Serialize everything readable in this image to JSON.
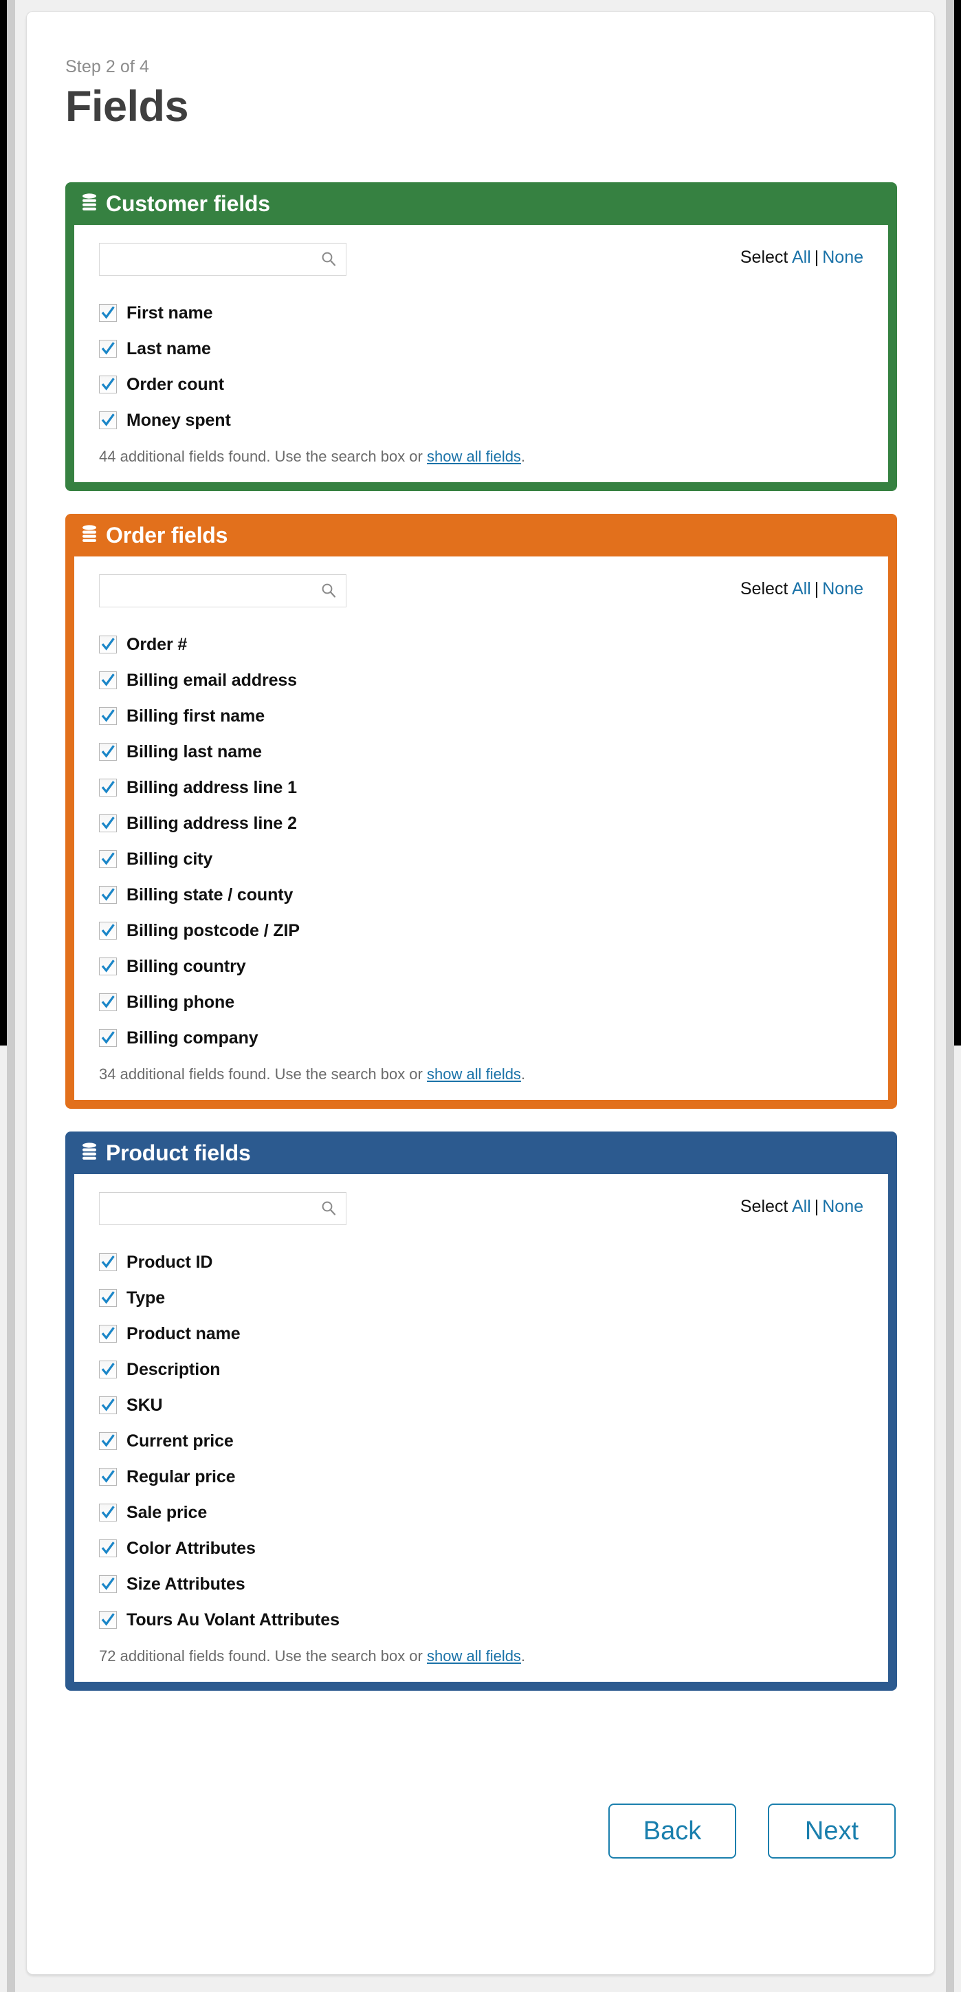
{
  "header": {
    "step_label": "Step 2 of 4",
    "title": "Fields"
  },
  "colors": {
    "customer_panel": "#368141",
    "order_panel": "#e2701c",
    "product_panel": "#2c5a8f",
    "link": "#1a72a8",
    "button_border": "#1a7fad",
    "checkbox_check": "#1a86c8"
  },
  "select_controls": {
    "prefix": "Select",
    "all_label": "All",
    "separator": "|",
    "none_label": "None"
  },
  "search": {
    "value": "",
    "placeholder": "",
    "icon": "search-icon"
  },
  "more_note": {
    "middle": " additional fields found. Use the search box or ",
    "link_label": "show all fields",
    "suffix": "."
  },
  "panels": [
    {
      "id": "customer-fields",
      "title": "Customer fields",
      "icon": "database-icon",
      "accent": "#368141",
      "additional_count": "44",
      "fields": [
        {
          "label": "First name",
          "checked": true
        },
        {
          "label": "Last name",
          "checked": true
        },
        {
          "label": "Order count",
          "checked": true
        },
        {
          "label": "Money spent",
          "checked": true
        }
      ]
    },
    {
      "id": "order-fields",
      "title": "Order fields",
      "icon": "database-icon",
      "accent": "#e2701c",
      "additional_count": "34",
      "fields": [
        {
          "label": "Order #",
          "checked": true
        },
        {
          "label": "Billing email address",
          "checked": true
        },
        {
          "label": "Billing first name",
          "checked": true
        },
        {
          "label": "Billing last name",
          "checked": true
        },
        {
          "label": "Billing address line 1",
          "checked": true
        },
        {
          "label": "Billing address line 2",
          "checked": true
        },
        {
          "label": "Billing city",
          "checked": true
        },
        {
          "label": "Billing state / county",
          "checked": true
        },
        {
          "label": "Billing postcode / ZIP",
          "checked": true
        },
        {
          "label": "Billing country",
          "checked": true
        },
        {
          "label": "Billing phone",
          "checked": true
        },
        {
          "label": "Billing company",
          "checked": true
        }
      ]
    },
    {
      "id": "product-fields",
      "title": "Product fields",
      "icon": "database-icon",
      "accent": "#2c5a8f",
      "additional_count": "72",
      "fields": [
        {
          "label": "Product ID",
          "checked": true
        },
        {
          "label": "Type",
          "checked": true
        },
        {
          "label": "Product name",
          "checked": true
        },
        {
          "label": "Description",
          "checked": true
        },
        {
          "label": "SKU",
          "checked": true
        },
        {
          "label": "Current price",
          "checked": true
        },
        {
          "label": "Regular price",
          "checked": true
        },
        {
          "label": "Sale price",
          "checked": true
        },
        {
          "label": "Color Attributes",
          "checked": true
        },
        {
          "label": "Size Attributes",
          "checked": true
        },
        {
          "label": "Tours Au Volant Attributes",
          "checked": true
        }
      ]
    }
  ],
  "footer": {
    "back_label": "Back",
    "next_label": "Next"
  }
}
